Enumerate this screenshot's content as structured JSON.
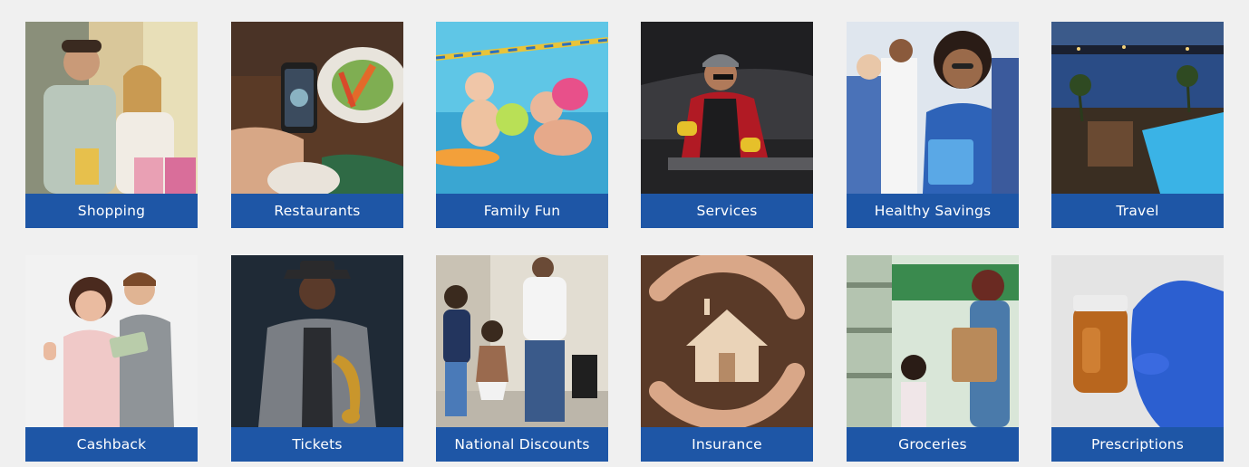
{
  "categories": [
    {
      "label": "Shopping",
      "icon": "shopping-photo"
    },
    {
      "label": "Restaurants",
      "icon": "restaurants-photo"
    },
    {
      "label": "Family Fun",
      "icon": "family-fun-photo"
    },
    {
      "label": "Services",
      "icon": "services-photo"
    },
    {
      "label": "Healthy Savings",
      "icon": "healthy-savings-photo"
    },
    {
      "label": "Travel",
      "icon": "travel-photo"
    },
    {
      "label": "Cashback",
      "icon": "cashback-photo"
    },
    {
      "label": "Tickets",
      "icon": "tickets-photo"
    },
    {
      "label": "National Discounts",
      "icon": "national-discounts-photo"
    },
    {
      "label": "Insurance",
      "icon": "insurance-photo"
    },
    {
      "label": "Groceries",
      "icon": "groceries-photo"
    },
    {
      "label": "Prescriptions",
      "icon": "prescriptions-photo"
    }
  ],
  "theme": {
    "label_bar": "#1e56a6",
    "page_background": "#f0f0f0"
  }
}
